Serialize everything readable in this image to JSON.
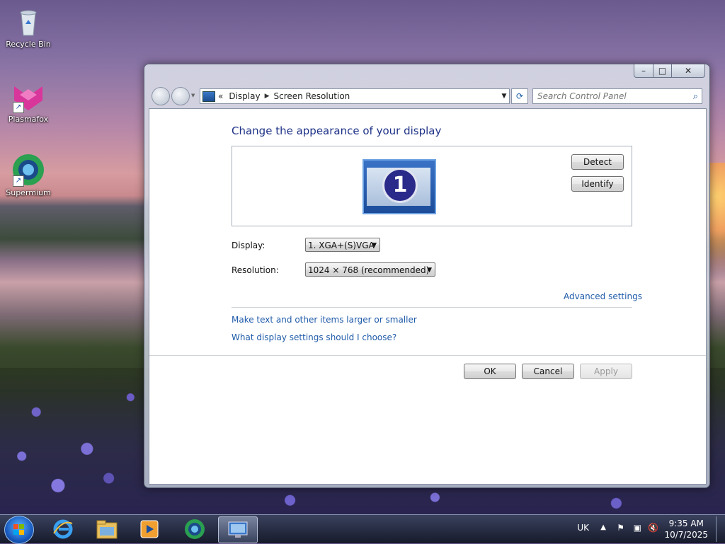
{
  "desktop": {
    "icons": [
      {
        "label": "Recycle Bin"
      },
      {
        "label": "Plasmafox"
      },
      {
        "label": "Supermium"
      }
    ]
  },
  "window": {
    "caption_buttons": {
      "minimize": "–",
      "maximize": "□",
      "close": "✕"
    },
    "breadcrumb": {
      "prefix": "«",
      "items": [
        "Display",
        "Screen Resolution"
      ]
    },
    "search_placeholder": "Search Control Panel",
    "heading": "Change the appearance of your display",
    "monitor_number": "1",
    "detect_button": "Detect",
    "identify_button": "Identify",
    "display_label": "Display:",
    "display_value": "1. XGA+(S)VGA",
    "resolution_label": "Resolution:",
    "resolution_value": "1024 × 768 (recommended)",
    "advanced_link": "Advanced settings",
    "links": [
      "Make text and other items larger or smaller",
      "What display settings should I choose?"
    ],
    "ok_button": "OK",
    "cancel_button": "Cancel",
    "apply_button": "Apply"
  },
  "taskbar": {
    "language": "UK",
    "time": "9:35 AM",
    "date": "10/7/2025"
  }
}
